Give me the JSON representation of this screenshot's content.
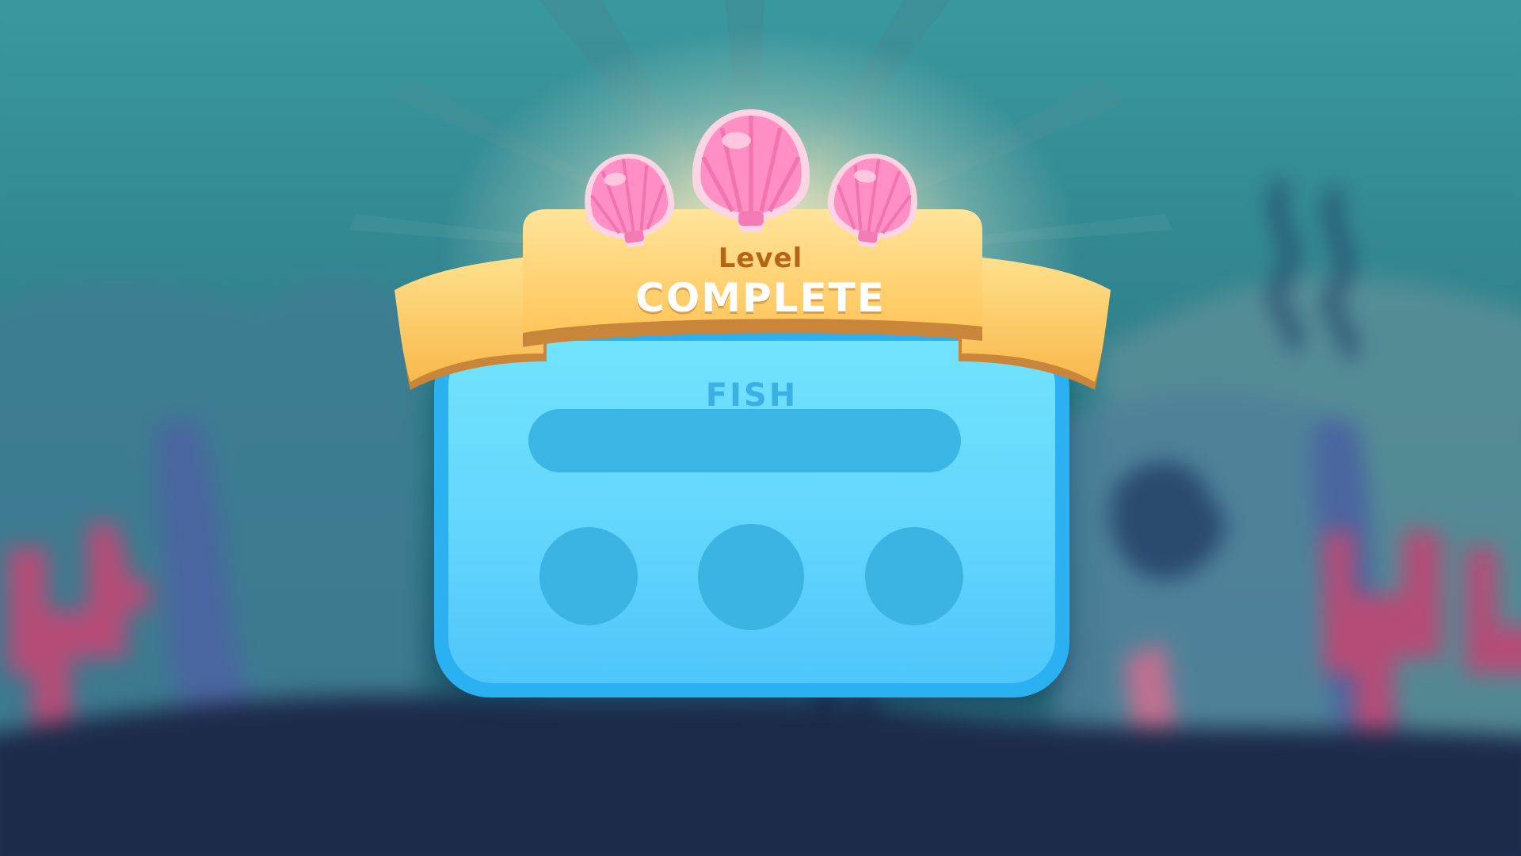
{
  "popup": {
    "header_small": "Level",
    "header_large": "COMPLETE",
    "title": "FISH",
    "progress": 0,
    "slots": [
      {
        "id": "slot-1",
        "filled": false
      },
      {
        "id": "slot-2",
        "filled": false
      },
      {
        "id": "slot-3",
        "filled": false
      }
    ]
  },
  "stars": {
    "earned": 3,
    "total": 3,
    "icon": "seashell-icon"
  },
  "colors": {
    "background_water": "#2f7f86",
    "banner": "#ffd06b",
    "banner_text": "#b46516",
    "panel": "#62d6fc",
    "panel_border": "#2bb0f2",
    "shell": "#ff8fc4"
  }
}
